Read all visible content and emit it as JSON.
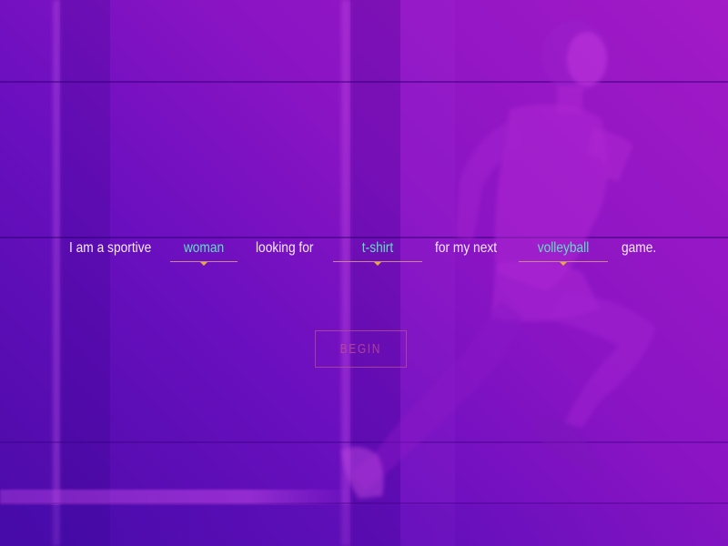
{
  "sentence": {
    "prefix": "I am a sportive",
    "gender": {
      "value": "woman"
    },
    "mid1": "looking for",
    "product": {
      "value": "t-shirt"
    },
    "mid2": "for my next",
    "sport": {
      "value": "volleyball"
    },
    "suffix": "game."
  },
  "actions": {
    "begin_label": "BEGIN"
  },
  "colors": {
    "text": "#f4ecff",
    "selected_value": "#5ee0c0",
    "underline": "#c58a8e",
    "caret": "#e6a93a",
    "begin": "#b94b96",
    "background_start": "#4a0ba8",
    "background_end": "#a31ac6"
  },
  "background": {
    "image_subject": "runner-woman-photo"
  }
}
